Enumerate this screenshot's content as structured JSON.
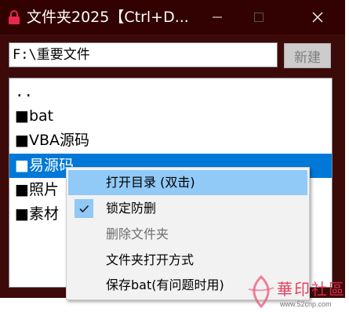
{
  "window": {
    "title": "文件夹2025【Ctrl+D...",
    "controls": {
      "minimize_icon": "minimize-icon",
      "maximize_icon": "maximize-icon",
      "close_icon": "close-icon"
    }
  },
  "path_input": {
    "value": "F:\\重要文件"
  },
  "new_button": {
    "label": "新建"
  },
  "file_list": {
    "items": [
      {
        "label": ".."
      },
      {
        "label": "■bat"
      },
      {
        "label": "■VBA源码"
      },
      {
        "label": "■易源码",
        "selected": true
      },
      {
        "label": "■照片"
      },
      {
        "label": "■素材"
      }
    ]
  },
  "context_menu": {
    "items": [
      {
        "label": "打开目录 (双击)",
        "highlighted": true
      },
      {
        "label": "锁定防删",
        "checked": true
      },
      {
        "label": "删除文件夹",
        "disabled": true
      },
      {
        "label": "文件夹打开方式"
      },
      {
        "label": "保存bat(有问题时用)"
      }
    ]
  },
  "watermark": {
    "text": "華印社區",
    "url": "www.52cnp.com"
  },
  "colors": {
    "titlebar": "#320202",
    "frame": "#3d0a0a",
    "selection": "#0078d7",
    "menu_highlight": "#91c9f7",
    "app_icon": "#e8284c"
  }
}
